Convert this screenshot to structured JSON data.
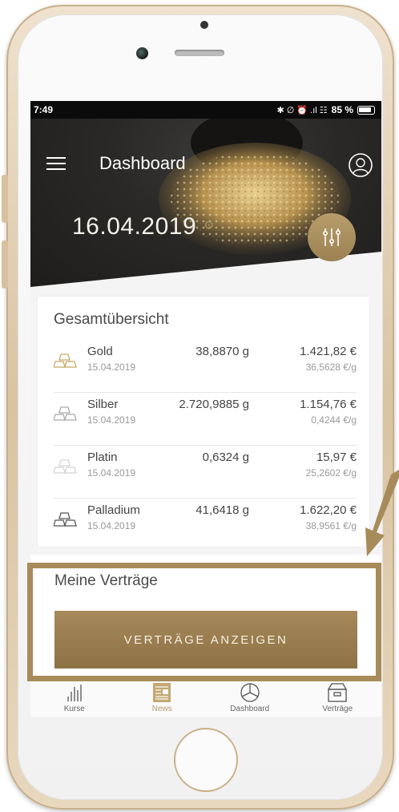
{
  "status": {
    "time": "7:49",
    "icons": "✱ ∅ ⏰ .ıl ☷",
    "battery": "85 %"
  },
  "header": {
    "title": "Dashboard",
    "menu_icon": "hamburger-menu-icon",
    "profile_icon": "user-profile-icon"
  },
  "hero": {
    "date": "16.04.2019",
    "settings_icon": "gear-icon",
    "filter_icon": "sliders-icon"
  },
  "overview": {
    "title": "Gesamtübersicht",
    "metals": [
      {
        "name": "Gold",
        "date": "15.04.2019",
        "weight": "38,8870 g",
        "value": "1.421,82 €",
        "rate": "36,5628 €/g",
        "color": "#c7a867"
      },
      {
        "name": "Silber",
        "date": "15.04.2019",
        "weight": "2.720,9885 g",
        "value": "1.154,76 €",
        "rate": "0,4244 €/g",
        "color": "#a9a9a9"
      },
      {
        "name": "Platin",
        "date": "15.04.2019",
        "weight": "0,6324 g",
        "value": "15,97 €",
        "rate": "25,2602 €/g",
        "color": "#d4d4d4"
      },
      {
        "name": "Palladium",
        "date": "15.04.2019",
        "weight": "41,6418 g",
        "value": "1.622,20 €",
        "rate": "38,9561 €/g",
        "color": "#555555"
      }
    ]
  },
  "contracts": {
    "title": "Meine Verträge",
    "button_label": "VERTRÄGE ANZEIGEN"
  },
  "tabbar": [
    {
      "label": "Kurse",
      "icon": "chart-bars-icon"
    },
    {
      "label": "News",
      "icon": "newspaper-icon",
      "active": true
    },
    {
      "label": "Dashboard",
      "icon": "pie-chart-icon"
    },
    {
      "label": "Verträge",
      "icon": "archive-box-icon"
    }
  ],
  "colors": {
    "accent": "#a88b5a",
    "gold": "#b89e6b"
  }
}
